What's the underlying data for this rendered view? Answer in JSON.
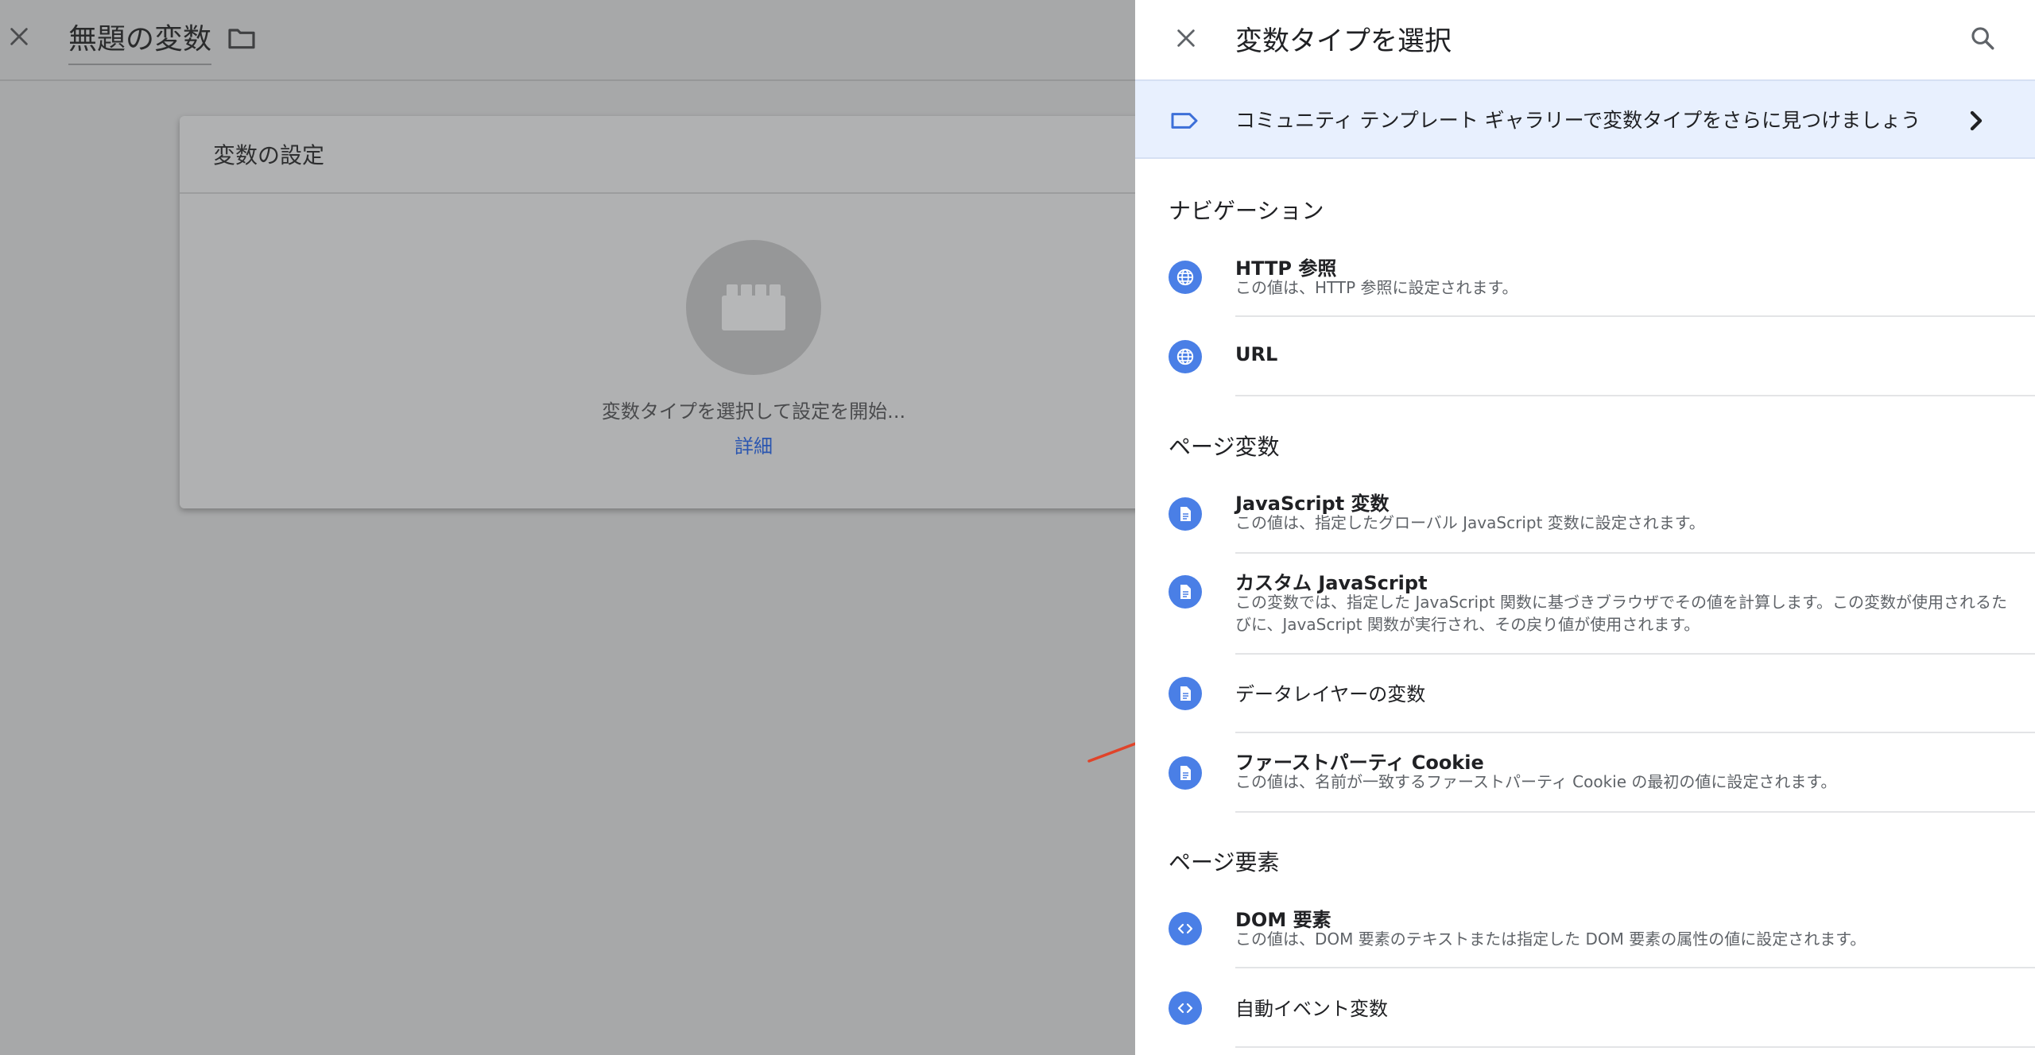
{
  "editor": {
    "title": "無題の変数",
    "card": {
      "title": "変数の設定",
      "hint": "変数タイプを選択して設定を開始...",
      "link": "詳細"
    }
  },
  "panel": {
    "title": "変数タイプを選択",
    "gallery_banner": "コミュニティ テンプレート ギャラリーで変数タイプをさらに見つけましょう",
    "sections": [
      {
        "heading": "ナビゲーション",
        "items": [
          {
            "title": "HTTP 参照",
            "desc": "この値は、HTTP 参照に設定されます。"
          },
          {
            "title": "URL",
            "desc": ""
          }
        ]
      },
      {
        "heading": "ページ変数",
        "items": [
          {
            "title": "JavaScript 変数",
            "desc": "この値は、指定したグローバル JavaScript 変数に設定されます。"
          },
          {
            "title": "カスタム JavaScript",
            "desc": "この変数では、指定した JavaScript 関数に基づきブラウザでその値を計算します。この変数が使用されるたびに、JavaScript 関数が実行され、その戻り値が使用されます。"
          },
          {
            "title": "データレイヤーの変数",
            "desc": ""
          },
          {
            "title": "ファーストパーティ Cookie",
            "desc": "この値は、名前が一致するファーストパーティ Cookie の最初の値に設定されます。"
          }
        ]
      },
      {
        "heading": "ページ要素",
        "items": [
          {
            "title": "DOM 要素",
            "desc": "この値は、DOM 要素のテキストまたは指定した DOM 要素の属性の値に設定されます。"
          },
          {
            "title": "自動イベント変数",
            "desc": ""
          }
        ]
      }
    ]
  },
  "icons": {
    "close": "close-icon",
    "folder": "folder-icon",
    "search": "search-icon",
    "label": "label-icon",
    "chevron": "chevron-right-icon",
    "globe": "globe-icon",
    "document": "document-icon",
    "code": "code-icon",
    "block": "building-block-icon"
  },
  "colors": {
    "accent": "#4a7fe6",
    "banner": "#e8f0fe",
    "link": "#2b56b0",
    "annotation": "#e0442a"
  }
}
